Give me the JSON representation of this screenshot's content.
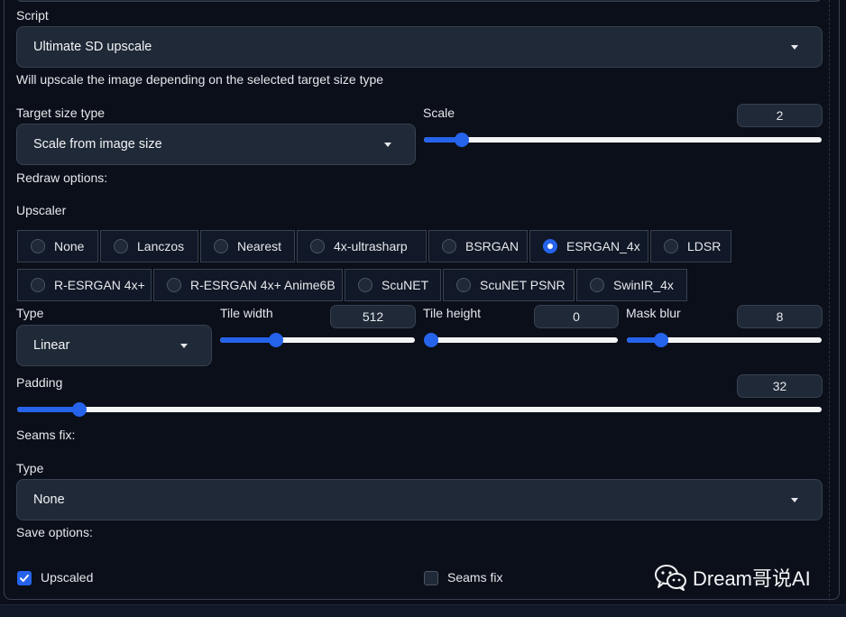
{
  "script": {
    "label": "Script",
    "selected": "Ultimate SD upscale"
  },
  "description": "Will upscale the image depending on the selected target size type",
  "target_size_type": {
    "label": "Target size type",
    "selected": "Scale from image size"
  },
  "scale": {
    "label": "Scale",
    "value": "2",
    "fraction": 0.08
  },
  "redraw_options_label": "Redraw options:",
  "upscaler": {
    "label": "Upscaler",
    "options": [
      "None",
      "Lanczos",
      "Nearest",
      "4x-ultrasharp",
      "BSRGAN",
      "ESRGAN_4x",
      "LDSR",
      "R-ESRGAN 4x+",
      "R-ESRGAN 4x+ Anime6B",
      "ScuNET",
      "ScuNET PSNR",
      "SwinIR_4x"
    ],
    "selected": "ESRGAN_4x"
  },
  "redraw_type": {
    "label": "Type",
    "selected": "Linear"
  },
  "tile_width": {
    "label": "Tile width",
    "value": "512",
    "fraction": 0.27
  },
  "tile_height": {
    "label": "Tile height",
    "value": "0",
    "fraction": 0.0
  },
  "mask_blur": {
    "label": "Mask blur",
    "value": "8",
    "fraction": 0.15
  },
  "padding": {
    "label": "Padding",
    "value": "32",
    "fraction": 0.07
  },
  "seams_fix_label": "Seams fix:",
  "seams_type": {
    "label": "Type",
    "selected": "None"
  },
  "save_options_label": "Save options:",
  "save": {
    "upscaled": {
      "label": "Upscaled",
      "checked": true
    },
    "seams_fix": {
      "label": "Seams fix",
      "checked": false
    }
  },
  "watermark": {
    "text": "Dream哥说AI",
    "icon": "wechat-icon"
  },
  "colors": {
    "accent": "#2563eb",
    "background": "#0b0f19",
    "control": "#1f2937",
    "border": "#374151"
  }
}
